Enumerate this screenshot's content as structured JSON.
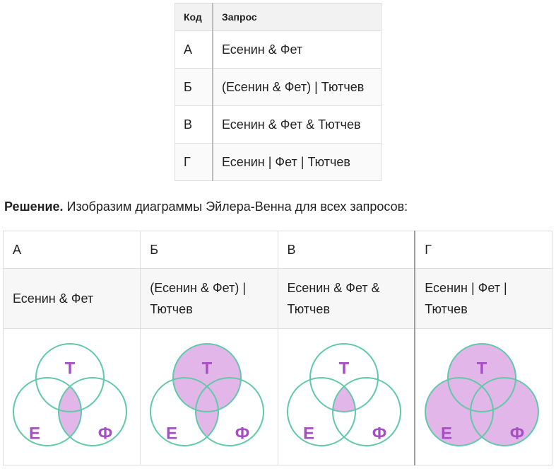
{
  "query_table": {
    "headers": {
      "code": "Код",
      "query": "Запрос"
    },
    "rows": [
      {
        "code": "А",
        "query": "Есенин & Фет"
      },
      {
        "code": "Б",
        "query": "(Есенин & Фет) | Тютчев"
      },
      {
        "code": "В",
        "query": "Есенин & Фет & Тютчев"
      },
      {
        "code": "Г",
        "query": "Есенин | Фет | Тютчев"
      }
    ]
  },
  "solution": {
    "bold": "Решение.",
    "text": " Изобразим диаграммы Эйлера-Венна для всех запросов:"
  },
  "venn_table": {
    "codes": [
      "А",
      "Б",
      "В",
      "Г"
    ],
    "queries": [
      [
        "Есенин & Фет"
      ],
      [
        "(Есенин & Фет) |",
        "Тютчев"
      ],
      [
        "Есенин & Фет &",
        "Тютчев"
      ],
      [
        "Есенин | Фет |",
        "Тютчев"
      ]
    ],
    "circle_labels": {
      "top": "Т",
      "left": "Е",
      "right": "Ф"
    }
  },
  "colors": {
    "outline": "#5fc9a8",
    "fill": "#e2b6e8",
    "label": "#a64ec4"
  }
}
